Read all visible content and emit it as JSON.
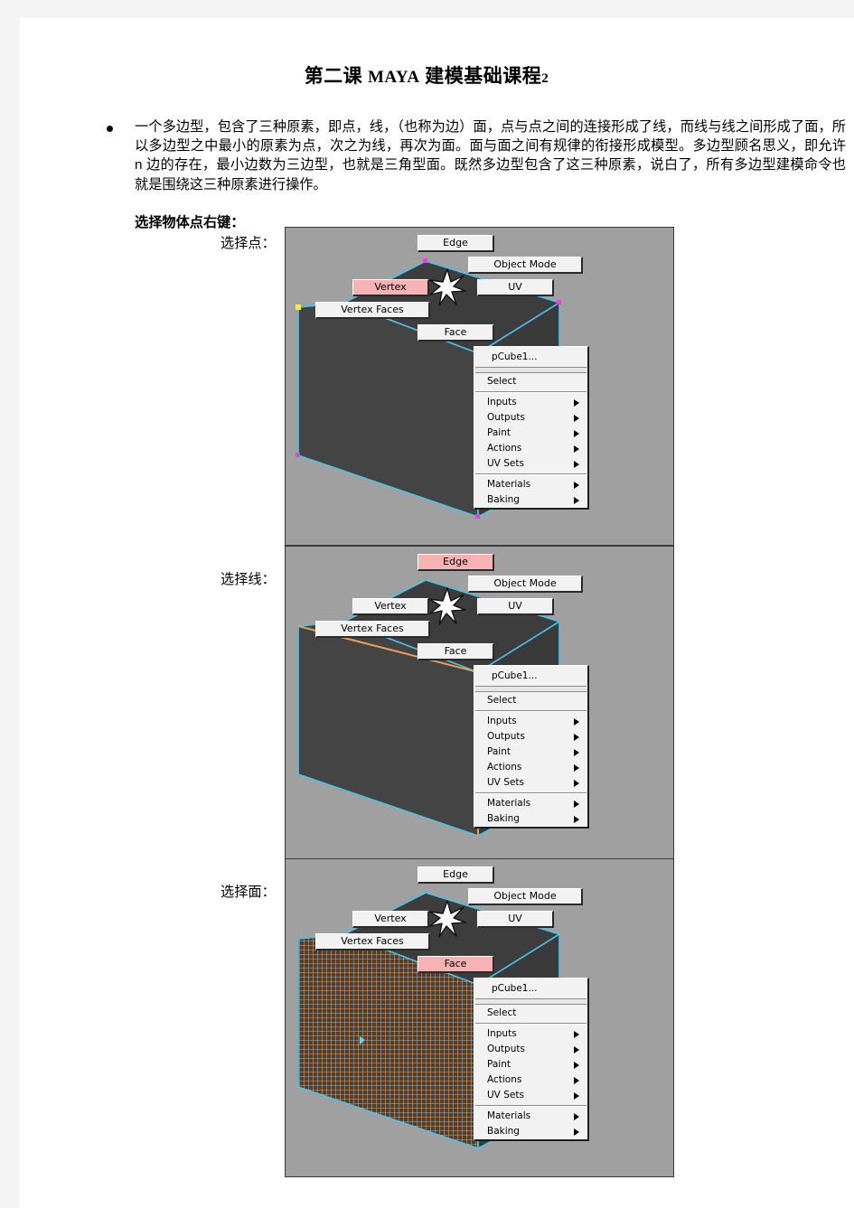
{
  "document": {
    "title_cn_prefix": "第二课",
    "title_brand": "MAYA",
    "title_cn_suffix": "建模基础课程",
    "title_number": "2",
    "paragraph": "一个多边型，包含了三种原素，即点，线，（也称为边）面，点与点之间的连接形成了线，而线与线之间形成了面，所以多边型之中最小的原素为点，次之为线，再次为面。面与面之间有规律的衔接形成模型。多边型顾名思义，即允许 n 边的存在，最小边数为三边型，也就是三角型面。既然多边型包含了这三种原素，说白了，所有多边型建模命令也就是围绕这三种原素进行操作。",
    "subheading": "选择物体点右键：",
    "label_vertex": "选择点：",
    "label_edge": "选择线：",
    "label_face": "选择面："
  },
  "marking_menu": {
    "edge": "Edge",
    "object_mode": "Object Mode",
    "vertex": "Vertex",
    "uv": "UV",
    "vertex_faces": "Vertex Faces",
    "face": "Face"
  },
  "context_menu": {
    "title": "pCube1...",
    "select": "Select",
    "inputs": "Inputs",
    "outputs": "Outputs",
    "paint": "Paint",
    "actions": "Actions",
    "uv_sets": "UV Sets",
    "materials": "Materials",
    "baking": "Baking"
  },
  "panels": [
    {
      "id": "panel-1",
      "active_mode": "Vertex",
      "caption": "选择点："
    },
    {
      "id": "panel-2",
      "active_mode": "Edge",
      "caption": "选择线："
    },
    {
      "id": "panel-3",
      "active_mode": "Face",
      "caption": "选择面："
    }
  ],
  "colors": {
    "viewport_bg": "#a0a0a0",
    "cube_fill": "#424242",
    "cube_top_fill": "#3d3d3d",
    "wireframe": "#4cc3e8",
    "highlight_pink": "#f7b3b3",
    "selected_orange": "#e8a05c",
    "vertex_yellow": "#ffee33",
    "vertex_magenta": "#d64ad6",
    "page_bg": "#ffffff",
    "margin_bg": "#f4f4f4"
  }
}
